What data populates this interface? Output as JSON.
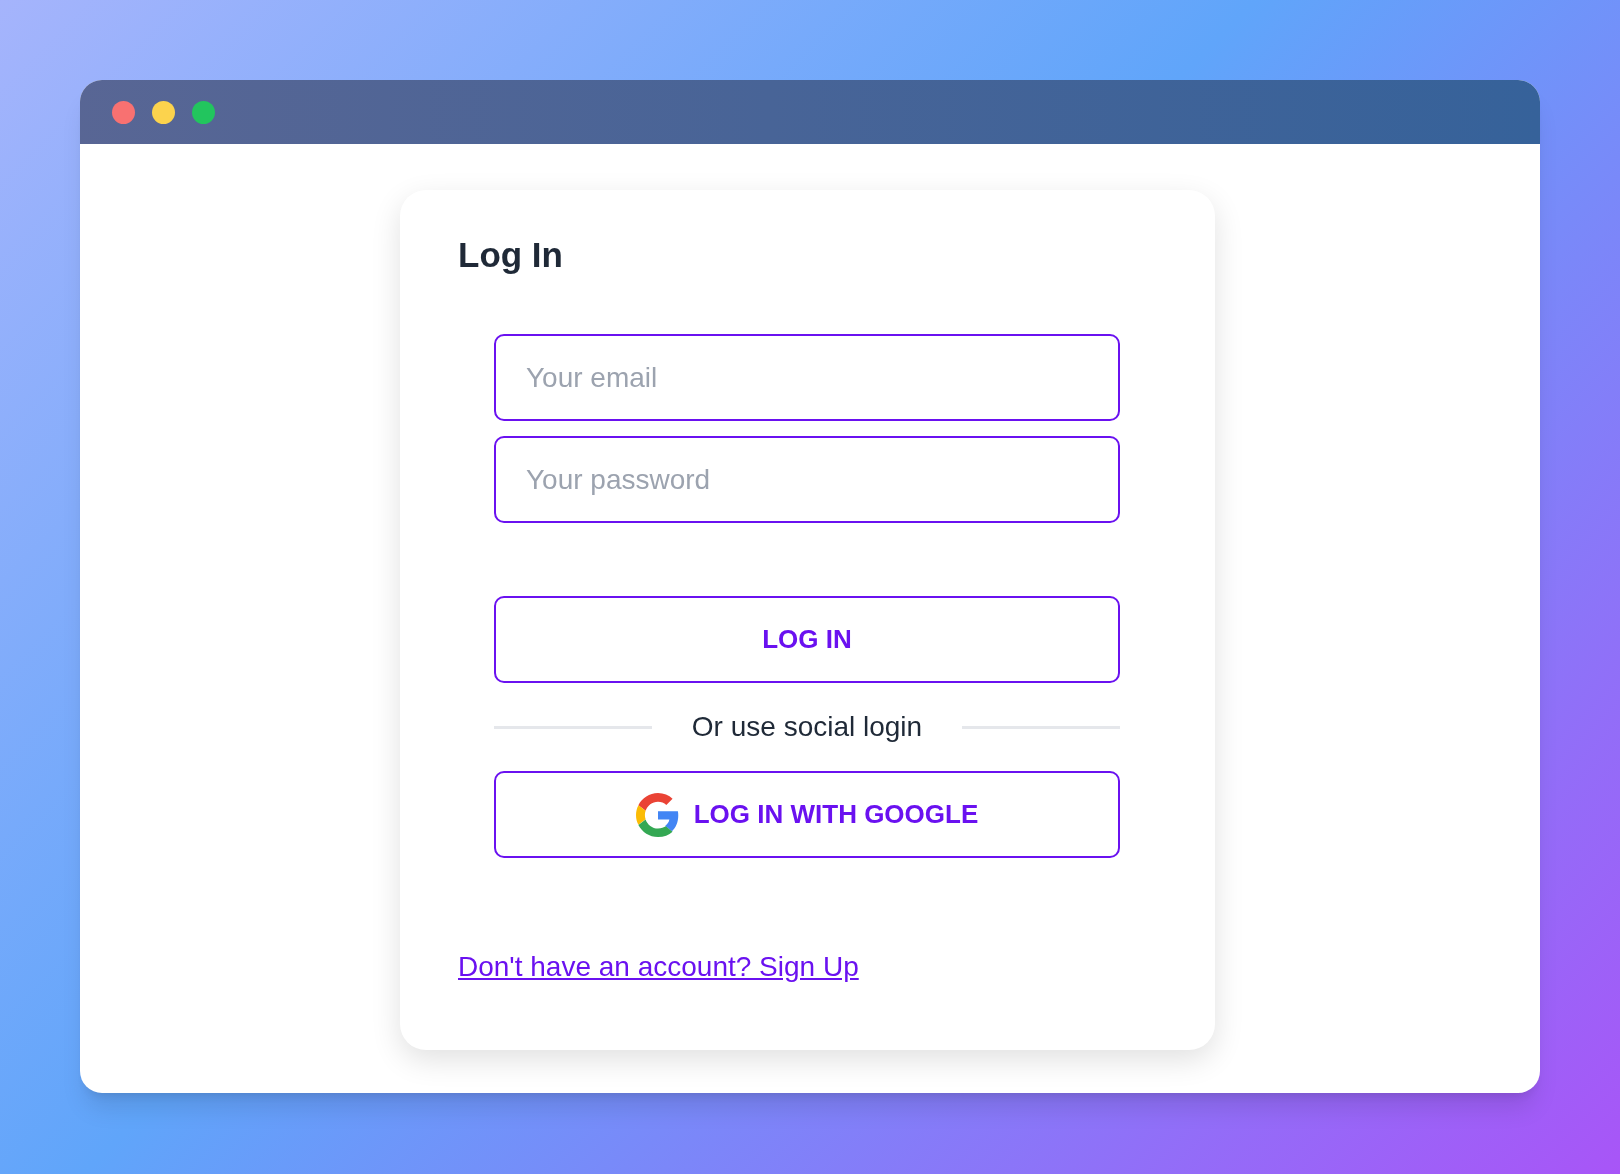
{
  "card": {
    "title": "Log In",
    "fields": [
      {
        "placeholder": "Your email"
      },
      {
        "placeholder": "Your password"
      }
    ],
    "login_button": "LOG IN",
    "divider": "Or use social login",
    "google_button": "LOG IN WITH GOOGLE",
    "signup_link": "Don't have an account? Sign Up"
  }
}
